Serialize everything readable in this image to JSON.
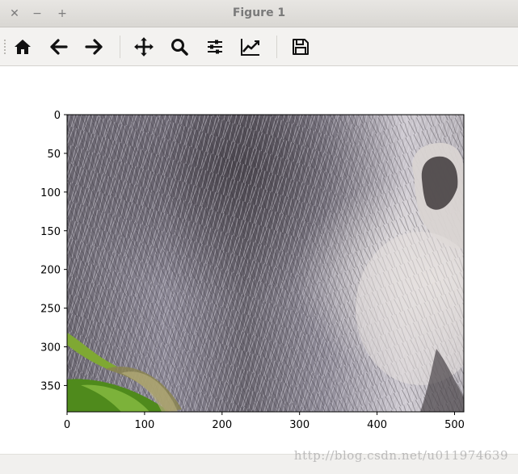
{
  "window": {
    "title": "Figure 1",
    "close_glyph": "✕",
    "minimize_glyph": "−",
    "maximize_glyph": "+"
  },
  "toolbar": {
    "buttons": [
      {
        "name": "home-icon"
      },
      {
        "name": "back-icon"
      },
      {
        "name": "forward-icon"
      },
      {
        "name": "pan-icon"
      },
      {
        "name": "zoom-icon"
      },
      {
        "name": "configure-subplots-icon"
      },
      {
        "name": "edit-axes-icon"
      },
      {
        "name": "save-icon"
      }
    ]
  },
  "plot": {
    "x_ticks": [
      "0",
      "100",
      "200",
      "300",
      "400",
      "500"
    ],
    "y_ticks": [
      "0",
      "50",
      "100",
      "150",
      "200",
      "250",
      "300",
      "350"
    ],
    "image_description_colors": {
      "fur_dark": "#4e4a52",
      "fur_light": "#c9c6d0",
      "ear_light": "#e6e2e0",
      "grass": "#6f9a2a"
    }
  },
  "watermark": "http://blog.csdn.net/u011974639"
}
